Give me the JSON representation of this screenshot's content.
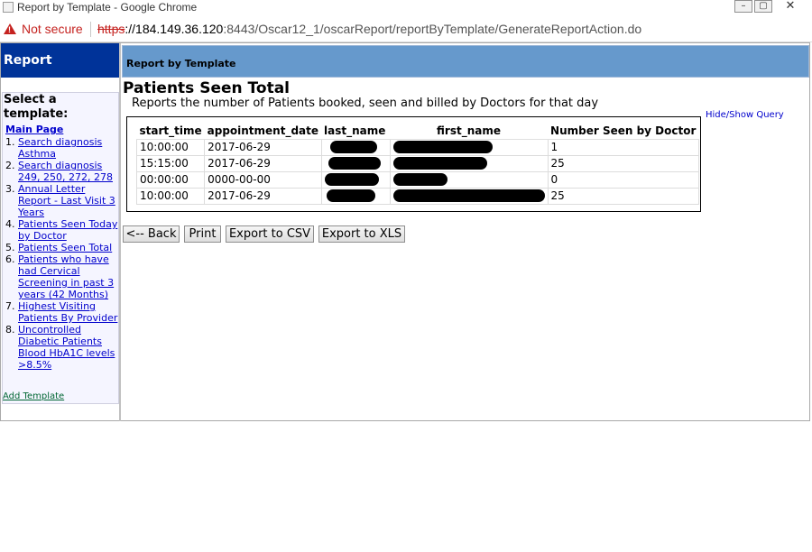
{
  "window": {
    "title": "Report by Template - Google Chrome",
    "controls": [
      "–",
      "▢",
      "✕"
    ]
  },
  "address_bar": {
    "security_label": "Not secure",
    "url_scheme": "https",
    "url_host": "://184.149.36.120",
    "url_port": ":8443",
    "url_path": "/Oscar12_1/oscarReport/reportByTemplate/GenerateReportAction.do"
  },
  "left_panel": {
    "header": "Report",
    "heading": "Select a template:",
    "main_page": "Main Page",
    "templates": [
      {
        "num": "1.",
        "label": "Search diagnosis Asthma"
      },
      {
        "num": "2.",
        "label": "Search diagnosis 249, 250, 272, 278"
      },
      {
        "num": "3.",
        "label": "Annual Letter Report - Last Visit 3 Years"
      },
      {
        "num": "4.",
        "label": "Patients Seen Today by Doctor"
      },
      {
        "num": "5.",
        "label": "Patients Seen Total"
      },
      {
        "num": "6.",
        "label": "Patients who have had Cervical Screening in past 3 years (42 Months)"
      },
      {
        "num": "7.",
        "label": "Highest Visiting Patients By Provider"
      },
      {
        "num": "8.",
        "label": "Uncontrolled Diabetic Patients Blood HbA1C levels >8.5%"
      }
    ],
    "add_template": "Add Template"
  },
  "main": {
    "header": "Report by Template",
    "title": "Patients Seen Total",
    "description": "Reports the number of Patients booked, seen and billed by Doctors for that day",
    "hide_show_query": "Hide/Show Query",
    "table": {
      "columns": [
        "start_time",
        "appointment_date",
        "last_name",
        "first_name",
        "Number Seen by Doctor"
      ],
      "rows": [
        {
          "start_time": "10:00:00",
          "appointment_date": "2017-06-29",
          "count": "1"
        },
        {
          "start_time": "15:15:00",
          "appointment_date": "2017-06-29",
          "count": "25"
        },
        {
          "start_time": "00:00:00",
          "appointment_date": "0000-00-00",
          "count": "0"
        },
        {
          "start_time": "10:00:00",
          "appointment_date": "2017-06-29",
          "count": "25"
        }
      ]
    },
    "buttons": {
      "back": "<-- Back",
      "print": "Print",
      "export_csv": "Export to CSV",
      "export_xls": "Export to XLS"
    }
  },
  "colors": {
    "left_header_bg": "#003399",
    "right_header_bg": "#6699cc",
    "link": "#0000cc",
    "warning_red": "#c5221f"
  }
}
